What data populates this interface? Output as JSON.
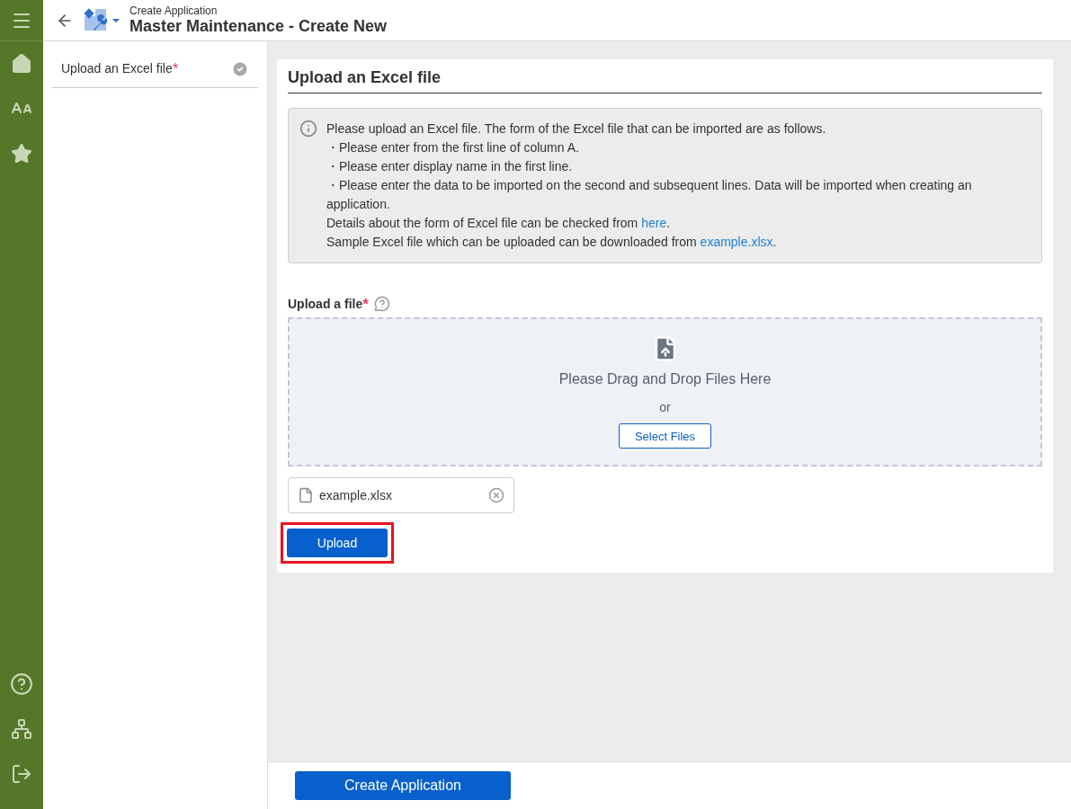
{
  "header": {
    "breadcrumb": "Create Application",
    "title": "Master Maintenance - Create New"
  },
  "steps": [
    {
      "label": "Upload an Excel file",
      "required_mark": "*",
      "checked": true
    }
  ],
  "section": {
    "title": "Upload an Excel file",
    "info": [
      {
        "text": "Please upload an Excel file. The form of the Excel file that can be imported are as follows."
      },
      {
        "text": "・Please enter from the first line of column A."
      },
      {
        "text": "・Please enter display name in the first line."
      },
      {
        "text": "・Please enter the data to be imported on the second and subsequent lines. Data will be imported when creating an application."
      },
      {
        "text": "Details about the form of Excel file can be checked from ",
        "link": "here",
        "after": "."
      },
      {
        "text": "Sample Excel file which can be uploaded can be downloaded from ",
        "link": "example.xlsx",
        "after": "."
      }
    ],
    "field_label": "Upload a file",
    "field_required_mark": "*",
    "dropzone": {
      "text": "Please Drag and Drop Files Here",
      "or": "or",
      "button": "Select Files"
    },
    "files": [
      {
        "name": "example.xlsx"
      }
    ],
    "upload_button": {
      "label": "Upload",
      "highlighted": true
    }
  },
  "footer": {
    "button": "Create Application"
  }
}
